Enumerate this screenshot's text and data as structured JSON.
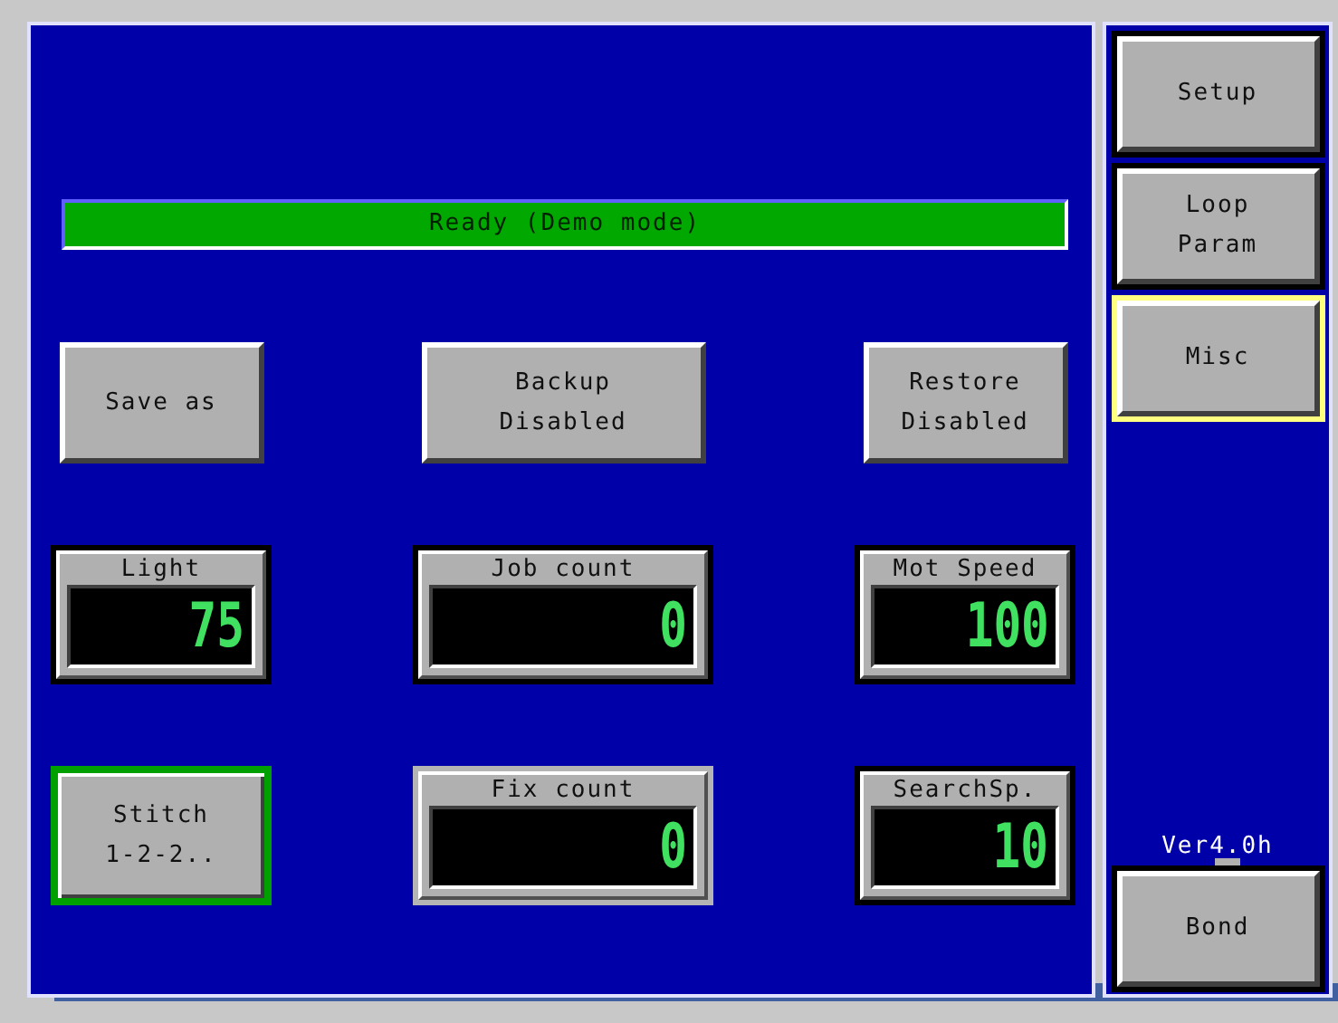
{
  "status": {
    "text": "Ready (Demo mode)"
  },
  "buttons": [
    {
      "label": "Save as"
    },
    {
      "label": "Backup\nDisabled"
    },
    {
      "label": "Restore\nDisabled"
    }
  ],
  "displays": [
    {
      "label": "Light",
      "value": "75",
      "color": "#000000"
    },
    {
      "label": "Job count",
      "value": "0",
      "color": "#000000"
    },
    {
      "label": "Mot Speed",
      "value": "100",
      "color": "#000000"
    },
    {
      "label": "Fix count",
      "value": "0",
      "color": "#b4b4b4"
    },
    {
      "label": "SearchSp.",
      "value": "10",
      "color": "#000000"
    }
  ],
  "stitch_button": {
    "label": "Stitch\n1-2-2..",
    "color": "#00a000"
  },
  "sidebar": {
    "items": [
      {
        "label": "Setup",
        "selected": false
      },
      {
        "label": "Loop\nParam",
        "selected": false
      },
      {
        "label": "Misc",
        "selected": true
      }
    ],
    "version": "Ver4.0h",
    "bottom_button": {
      "label": "Bond"
    }
  }
}
